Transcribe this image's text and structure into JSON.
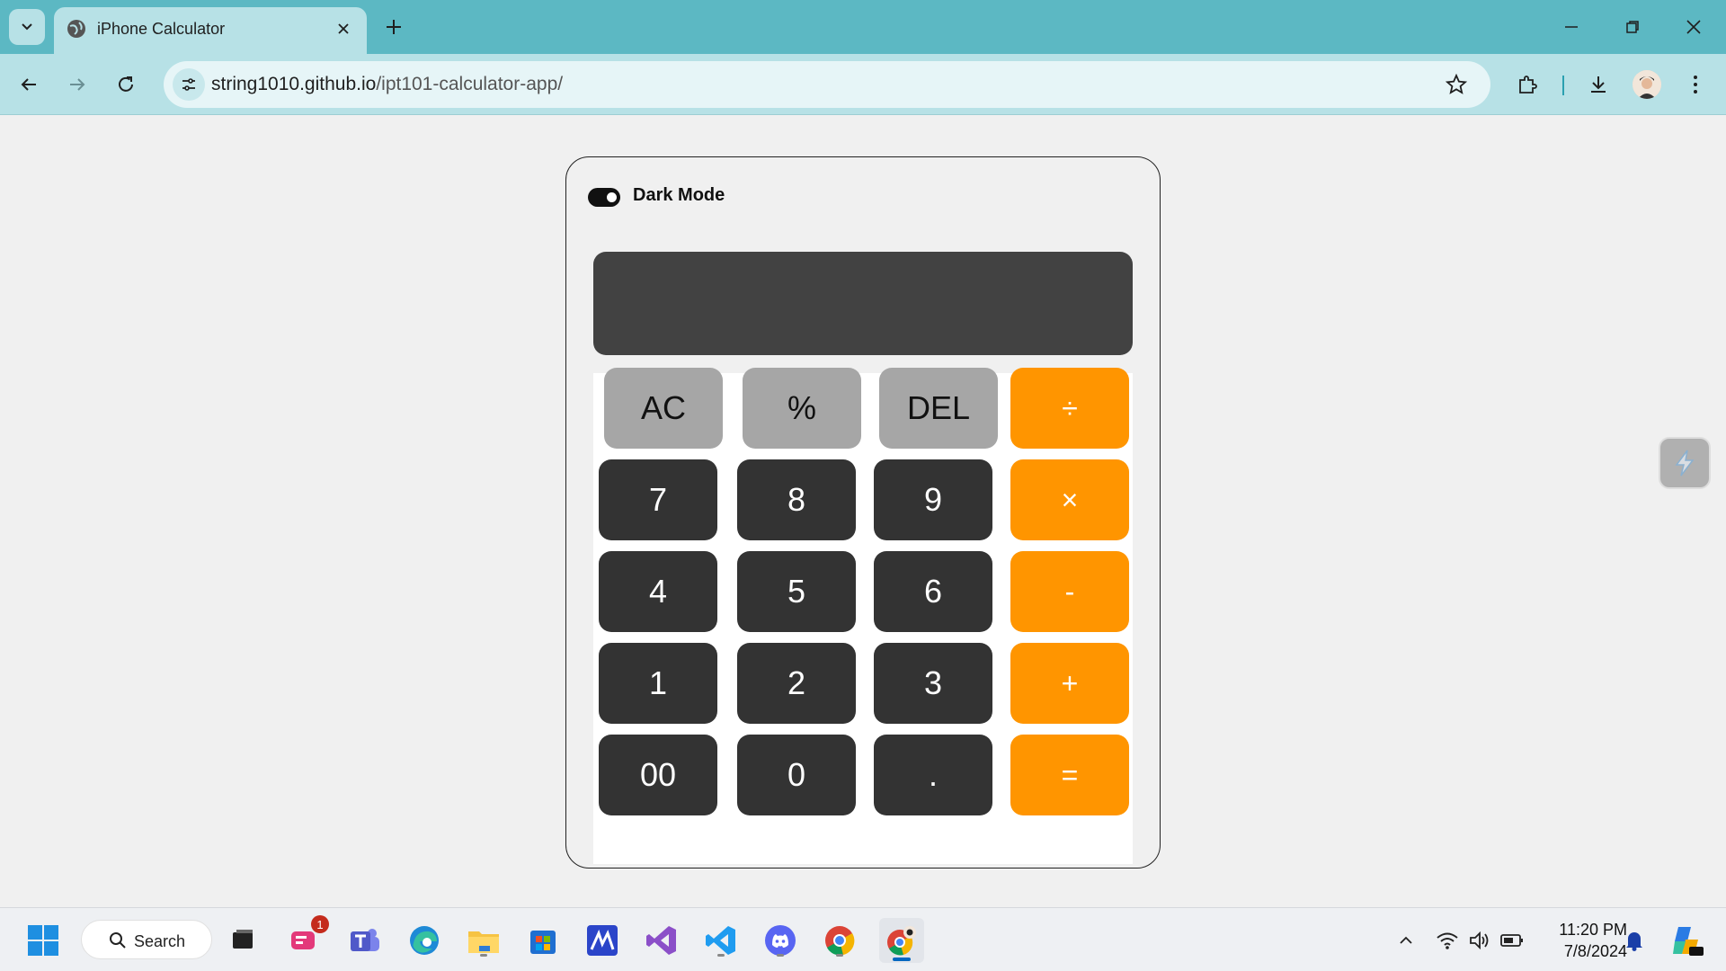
{
  "browser": {
    "tab_title": "iPhone Calculator",
    "url_domain": "string1010.github.io",
    "url_path": "/ipt101-calculator-app/"
  },
  "calculator": {
    "dark_mode_label": "Dark Mode",
    "dark_mode_on": true,
    "display_value": "",
    "keys": [
      [
        "AC",
        "%",
        "DEL",
        "÷"
      ],
      [
        "7",
        "8",
        "9",
        "×"
      ],
      [
        "4",
        "5",
        "6",
        "-"
      ],
      [
        "1",
        "2",
        "3",
        "+"
      ],
      [
        "00",
        "0",
        ".",
        "="
      ]
    ],
    "colors": {
      "display": "#424242",
      "function_key": "#a6a6a6",
      "number_key": "#333333",
      "operator_key": "#ff9500"
    }
  },
  "taskbar": {
    "search_label": "Search",
    "notification_badge": "1",
    "time": "11:20 PM",
    "date": "7/8/2024"
  },
  "colors": {
    "chrome_tabbar": "#5cb8c3",
    "chrome_toolbar": "#b7e1e6"
  }
}
